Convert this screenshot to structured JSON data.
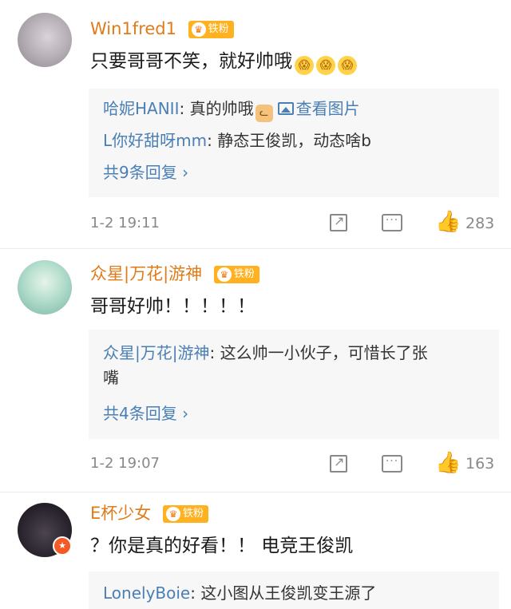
{
  "badge_label": "铁粉",
  "comments": [
    {
      "username": "Win1fred1",
      "text": "只要哥哥不笑，就好帅哦",
      "emoji": [
        "😱",
        "😱",
        "😱"
      ],
      "replies": [
        {
          "name": "哈妮HANII",
          "text": ": 真的帅哦",
          "emoji": "cat-face",
          "image_link": "查看图片"
        },
        {
          "name": "L你好甜呀mm",
          "text": ": 静态王俊凯，动态啥b"
        }
      ],
      "more_replies": "共9条回复 ›",
      "time": "1-2 19:11",
      "likes": "283"
    },
    {
      "username": "众星|万花|游神",
      "text": "哥哥好帅！！！！！",
      "replies": [
        {
          "name": "众星|万花|游神",
          "text": ": 这么帅一小伙子，可惜长了张",
          "text2": "嘴"
        }
      ],
      "more_replies": "共4条回复 ›",
      "time": "1-2 19:07",
      "likes": "163"
    },
    {
      "username": "E杯少女",
      "text": "？你是真的好看！！ 电竞王俊凯",
      "replies": [
        {
          "name": "LonelyBoie",
          "text": ": 这小图从王俊凯变王源了"
        }
      ]
    }
  ],
  "icons": {
    "share": "share-icon",
    "comment": "comment-icon",
    "like": "thumbs-up-icon",
    "image": "image-icon",
    "crown": "crown-icon"
  }
}
